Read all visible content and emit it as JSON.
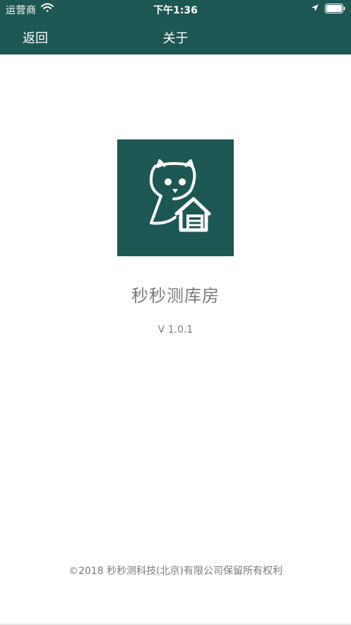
{
  "status_bar": {
    "carrier": "运营商",
    "time": "下午1:36",
    "icons": [
      "wifi-icon",
      "location-arrow-icon",
      "battery-icon"
    ]
  },
  "nav": {
    "back_label": "返回",
    "title": "关于"
  },
  "about": {
    "logo_icon": "owl-house-logo",
    "app_name": "秒秒测库房",
    "version": "V 1.0.1",
    "copyright": "©2018 秒秒测科技(北京)有限公司保留所有权利"
  },
  "colors": {
    "primary": "#1d5753",
    "text_gray": "#7a7a7a",
    "background": "#ffffff"
  }
}
